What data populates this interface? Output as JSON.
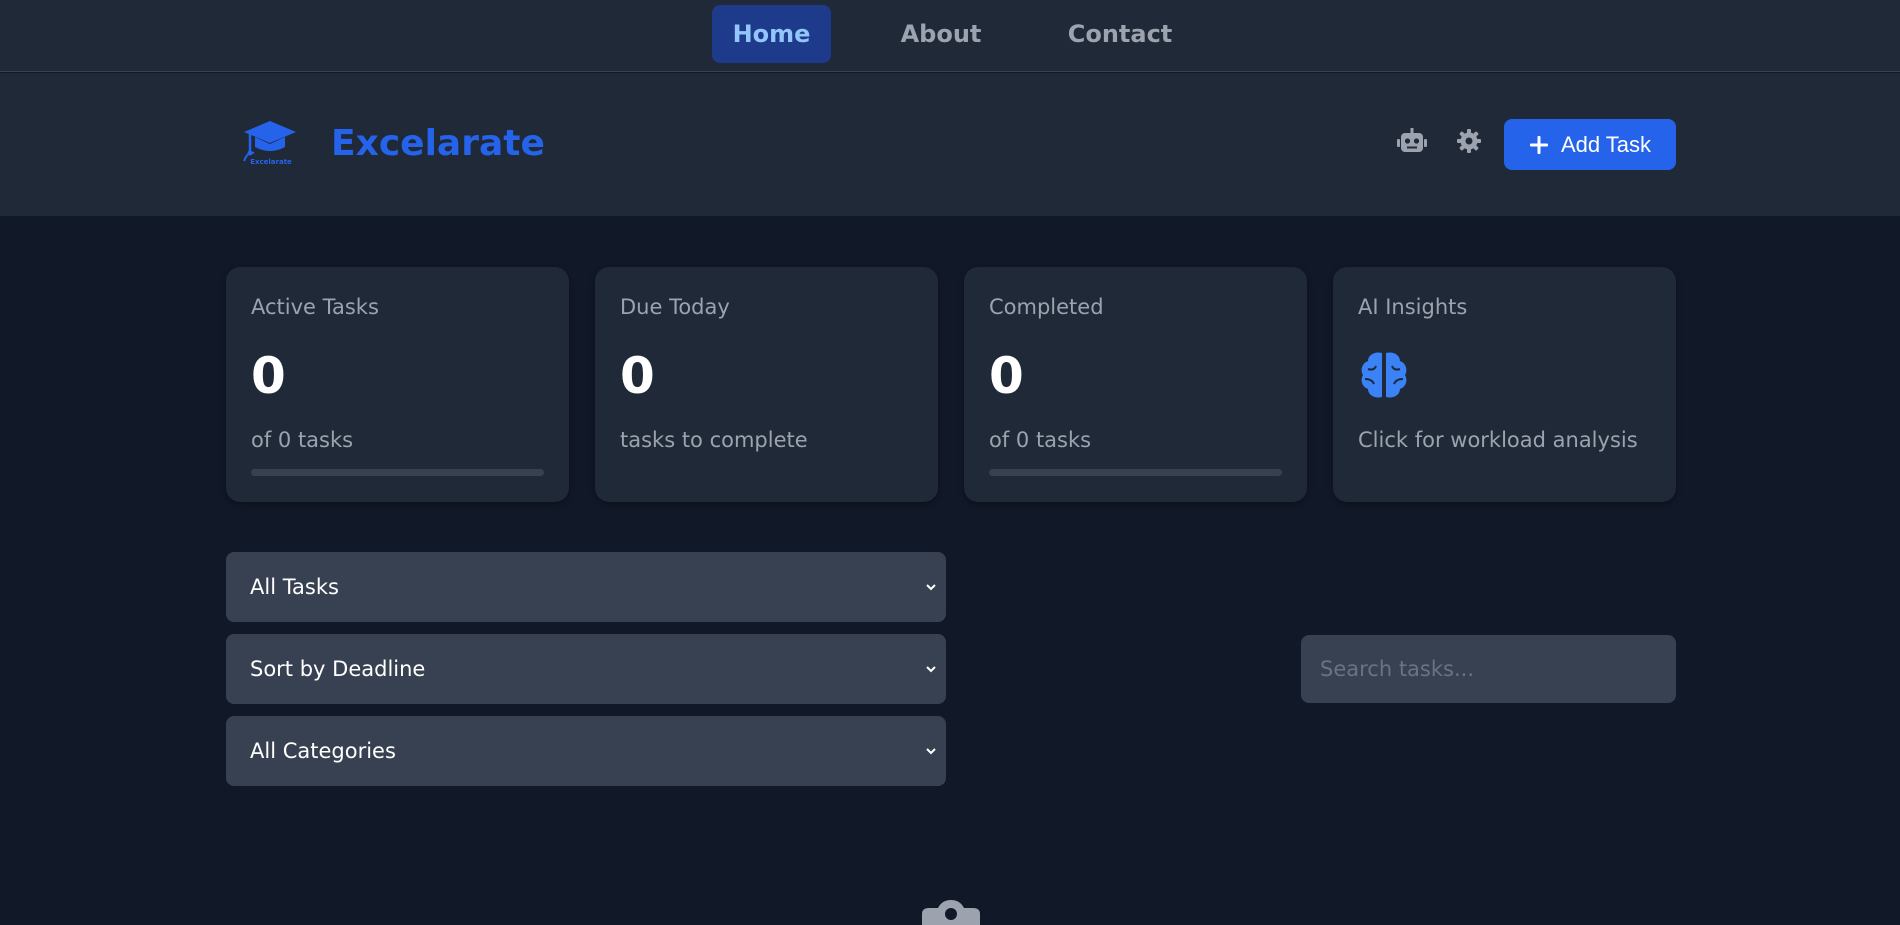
{
  "nav": {
    "items": [
      {
        "label": "Home",
        "active": true
      },
      {
        "label": "About",
        "active": false
      },
      {
        "label": "Contact",
        "active": false
      }
    ]
  },
  "header": {
    "brand": "Excelarate",
    "logo_text": "Excelarate",
    "logo_icon": "graduation-cap-icon",
    "actions": [
      {
        "icon": "robot-icon"
      },
      {
        "icon": "gear-icon"
      }
    ],
    "add_task_label": "Add Task"
  },
  "stats": [
    {
      "title": "Active Tasks",
      "value": "0",
      "sub": "of 0 tasks",
      "progress": 0
    },
    {
      "title": "Due Today",
      "value": "0",
      "sub": "tasks to complete"
    },
    {
      "title": "Completed",
      "value": "0",
      "sub": "of 0 tasks",
      "progress": 0
    },
    {
      "title": "AI Insights",
      "icon": "brain-icon",
      "sub": "Click for workload analysis"
    }
  ],
  "filters": {
    "status_selected": "All Tasks",
    "sort_selected": "Sort by Deadline",
    "category_selected": "All Categories"
  },
  "search": {
    "placeholder": "Search tasks...",
    "value": ""
  },
  "colors": {
    "accent": "#2563eb",
    "background": "#111827",
    "surface": "#1f2937",
    "input": "#374151",
    "muted_text": "#9ca3af"
  }
}
